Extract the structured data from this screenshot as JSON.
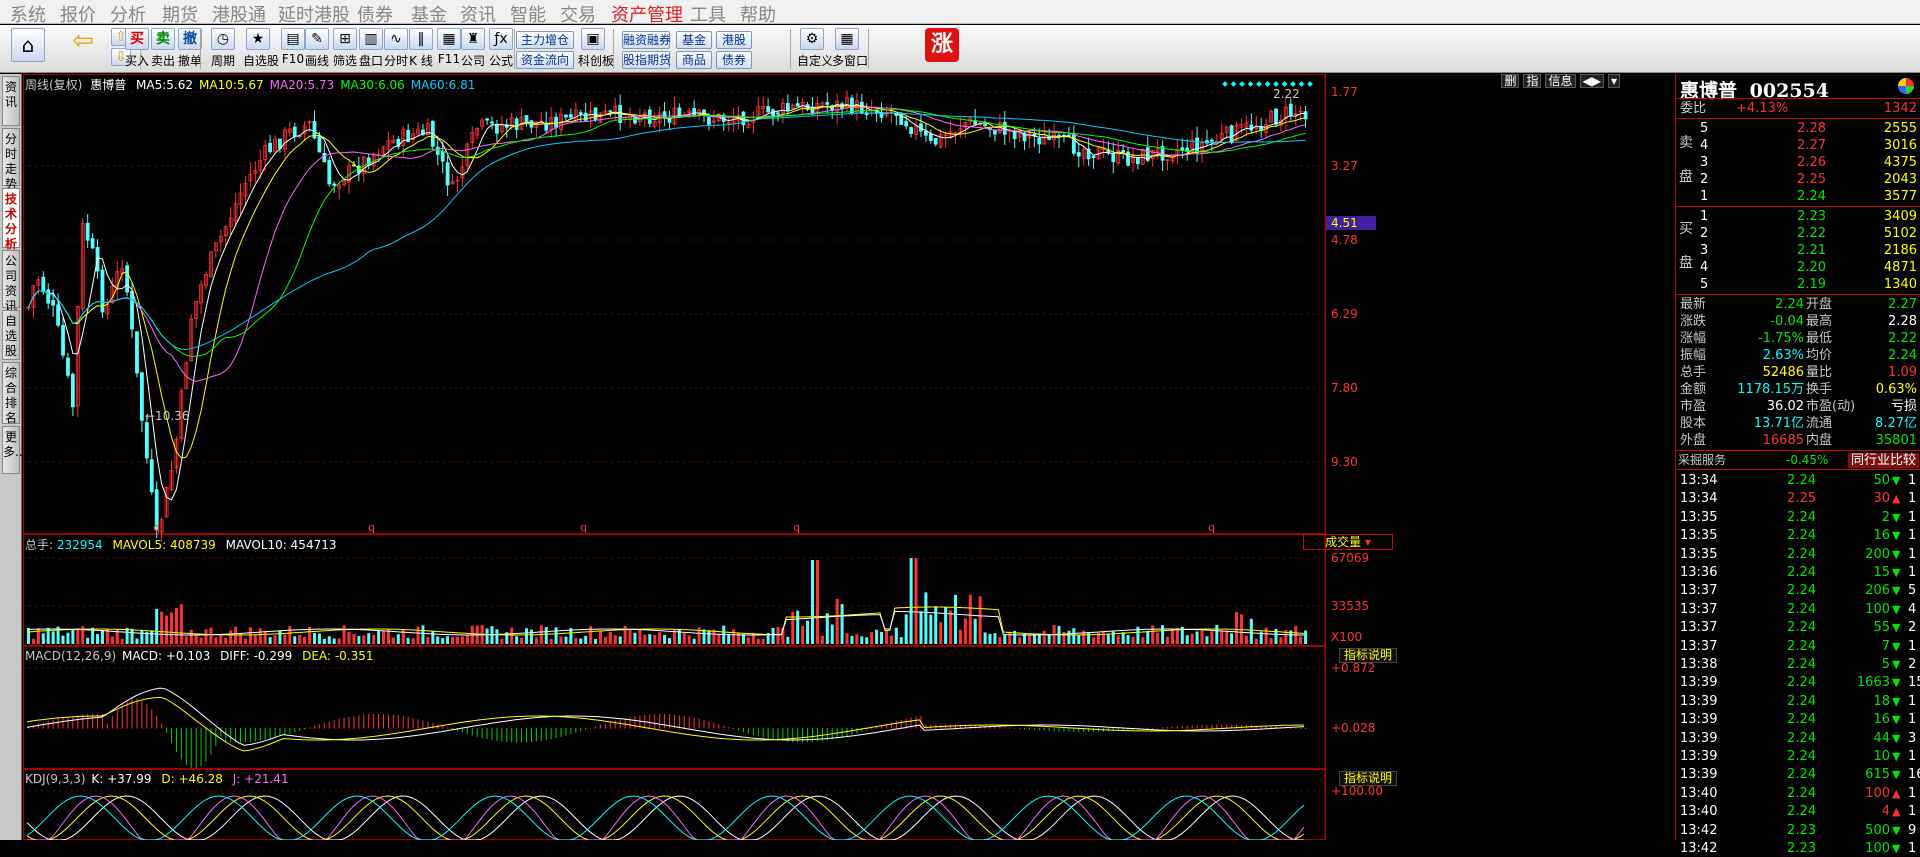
{
  "menu": [
    "系统",
    "报价",
    "分析",
    "期货",
    "港股通",
    "延时港股",
    "债券",
    "基金",
    "资讯",
    "智能",
    "交易",
    "资产管理",
    "工具",
    "帮助"
  ],
  "menu_active": "资产管理",
  "toolbar": {
    "buttons": [
      {
        "label": "买入",
        "icon": "买"
      },
      {
        "label": "卖出",
        "icon": "卖"
      },
      {
        "label": "撤单",
        "icon": "撤"
      },
      {
        "label": "周期",
        "icon": "◷"
      },
      {
        "label": "自选股",
        "icon": "★"
      },
      {
        "label": "F10",
        "icon": "▤"
      },
      {
        "label": "画线",
        "icon": "✎"
      },
      {
        "label": "筛选",
        "icon": "⊞"
      },
      {
        "label": "盘口",
        "icon": "▥"
      },
      {
        "label": "分时",
        "icon": "∿"
      },
      {
        "label": "K 线",
        "icon": "‖"
      },
      {
        "label": "F11",
        "icon": "▦"
      },
      {
        "label": "公司",
        "icon": "♜"
      },
      {
        "label": "公式",
        "icon": "ƒx"
      },
      {
        "label": "科创板",
        "icon": "▣"
      },
      {
        "label": "自定义",
        "icon": "⚙"
      },
      {
        "label": "多窗口",
        "icon": "▦"
      }
    ],
    "pills": [
      "主力增仓",
      "资金流向",
      "融资融券",
      "股指期货",
      "基金",
      "商品",
      "港股",
      "债券"
    ],
    "zhang_icon": "涨"
  },
  "sidebar_tabs": [
    "资讯",
    "分时走势",
    "技术分析",
    "公司资讯",
    "自选股",
    "综合排名",
    "更多..."
  ],
  "sidebar_active": 2,
  "kline": {
    "period_label": "周线(复权)",
    "stock_name": "惠博普",
    "ma": [
      {
        "label": "MA5:",
        "value": "5.62",
        "color": "#ffffff"
      },
      {
        "label": "MA10:",
        "value": "5.67",
        "color": "#ffff00"
      },
      {
        "label": "MA20:",
        "value": "5.73",
        "color": "#ff66ff"
      },
      {
        "label": "MA30:",
        "value": "6.06",
        "color": "#00ff00"
      },
      {
        "label": "MA60:",
        "value": "6.81",
        "color": "#00ccff"
      }
    ],
    "price_ticks": [
      "1.77",
      "3.27",
      "4.78",
      "6.29",
      "7.80",
      "9.30"
    ],
    "cursor_price": "4.51",
    "low_label": "←10.36",
    "high_label": "2.22",
    "top_buttons": [
      "删",
      "指",
      "信息",
      "◀▶",
      "▾"
    ],
    "q_marks": [
      "q",
      "q",
      "q",
      "q",
      "q"
    ]
  },
  "volume": {
    "label": "总手:",
    "value": "232954",
    "mavol5_label": "MAVOL5:",
    "mavol5": "408739",
    "mavol10_label": "MAVOL10:",
    "mavol10": "454713",
    "ticks": [
      "67069",
      "33535",
      "X100"
    ],
    "selector": "成交量"
  },
  "macd": {
    "label": "MACD(12,26,9)",
    "macd_label": "MACD:",
    "macd_value": "+0.103",
    "diff_label": "DIFF:",
    "diff_value": "-0.299",
    "dea_label": "DEA:",
    "dea_value": "-0.351",
    "ticks": [
      "+0.872",
      "+0.028"
    ],
    "help": "指标说明"
  },
  "kdj": {
    "label": "KDJ(9,3,3)",
    "k_label": "K:",
    "k": "+37.99",
    "d_label": "D:",
    "d": "+46.28",
    "j_label": "J:",
    "j": "+21.41",
    "ticks": [
      "+100.00"
    ],
    "help": "指标说明"
  },
  "quote": {
    "name": "惠博普",
    "code": "002554",
    "weibi_label": "委比",
    "weibi": "+4.13%",
    "weicha": "1342",
    "sell_label": [
      "卖",
      "盘"
    ],
    "buy_label": [
      "买",
      "盘"
    ],
    "sell": [
      {
        "lv": "5",
        "price": "2.28",
        "vol": "2555"
      },
      {
        "lv": "4",
        "price": "2.27",
        "vol": "3016"
      },
      {
        "lv": "3",
        "price": "2.26",
        "vol": "4375"
      },
      {
        "lv": "2",
        "price": "2.25",
        "vol": "2043"
      },
      {
        "lv": "1",
        "price": "2.24",
        "vol": "3577"
      }
    ],
    "buy": [
      {
        "lv": "1",
        "price": "2.23",
        "vol": "3409"
      },
      {
        "lv": "2",
        "price": "2.22",
        "vol": "5102"
      },
      {
        "lv": "3",
        "price": "2.21",
        "vol": "2186"
      },
      {
        "lv": "4",
        "price": "2.20",
        "vol": "4871"
      },
      {
        "lv": "5",
        "price": "2.19",
        "vol": "1340"
      }
    ],
    "stats": [
      {
        "l1": "最新",
        "v1": "2.24",
        "c1": "green",
        "l2": "开盘",
        "v2": "2.27",
        "c2": "green"
      },
      {
        "l1": "涨跌",
        "v1": "-0.04",
        "c1": "green",
        "l2": "最高",
        "v2": "2.28",
        "c2": "white"
      },
      {
        "l1": "涨幅",
        "v1": "-1.75%",
        "c1": "green",
        "l2": "最低",
        "v2": "2.22",
        "c2": "green"
      },
      {
        "l1": "振幅",
        "v1": "2.63%",
        "c1": "cyan",
        "l2": "均价",
        "v2": "2.24",
        "c2": "green"
      },
      {
        "l1": "总手",
        "v1": "52486",
        "c1": "yellow",
        "l2": "量比",
        "v2": "1.09",
        "c2": "red"
      },
      {
        "l1": "金额",
        "v1": "1178.15万",
        "c1": "cyan",
        "l2": "换手",
        "v2": "0.63%",
        "c2": "yellow"
      },
      {
        "l1": "市盈",
        "v1": "36.02",
        "c1": "white",
        "l2": "市盈(动)",
        "v2": "亏损",
        "c2": "white"
      },
      {
        "l1": "股本",
        "v1": "13.71亿",
        "c1": "cyan",
        "l2": "流通",
        "v2": "8.27亿",
        "c2": "cyan"
      },
      {
        "l1": "外盘",
        "v1": "16685",
        "c1": "red",
        "l2": "内盘",
        "v2": "35801",
        "c2": "green"
      }
    ],
    "sector_label": "采掘服务",
    "sector_change": "-0.45%",
    "compare_btn": "同行业比较",
    "ticks": [
      {
        "t": "13:34",
        "p": "2.24",
        "v": "50",
        "d": "down",
        "n": "1"
      },
      {
        "t": "13:34",
        "p": "2.25",
        "v": "30",
        "d": "up",
        "n": "1"
      },
      {
        "t": "13:35",
        "p": "2.24",
        "v": "2",
        "d": "down",
        "n": "1"
      },
      {
        "t": "13:35",
        "p": "2.24",
        "v": "16",
        "d": "down",
        "n": "1"
      },
      {
        "t": "13:35",
        "p": "2.24",
        "v": "200",
        "d": "down",
        "n": "1"
      },
      {
        "t": "13:36",
        "p": "2.24",
        "v": "15",
        "d": "down",
        "n": "1"
      },
      {
        "t": "13:37",
        "p": "2.24",
        "v": "206",
        "d": "down",
        "n": "5"
      },
      {
        "t": "13:37",
        "p": "2.24",
        "v": "100",
        "d": "down",
        "n": "4"
      },
      {
        "t": "13:37",
        "p": "2.24",
        "v": "55",
        "d": "down",
        "n": "2"
      },
      {
        "t": "13:37",
        "p": "2.24",
        "v": "7",
        "d": "down",
        "n": "1"
      },
      {
        "t": "13:38",
        "p": "2.24",
        "v": "5",
        "d": "down",
        "n": "2"
      },
      {
        "t": "13:39",
        "p": "2.24",
        "v": "1663",
        "d": "down",
        "n": "15"
      },
      {
        "t": "13:39",
        "p": "2.24",
        "v": "18",
        "d": "down",
        "n": "1"
      },
      {
        "t": "13:39",
        "p": "2.24",
        "v": "16",
        "d": "down",
        "n": "1"
      },
      {
        "t": "13:39",
        "p": "2.24",
        "v": "44",
        "d": "down",
        "n": "3"
      },
      {
        "t": "13:39",
        "p": "2.24",
        "v": "10",
        "d": "down",
        "n": "1"
      },
      {
        "t": "13:39",
        "p": "2.24",
        "v": "615",
        "d": "down",
        "n": "16"
      },
      {
        "t": "13:40",
        "p": "2.24",
        "v": "100",
        "d": "up",
        "n": "1"
      },
      {
        "t": "13:40",
        "p": "2.24",
        "v": "4",
        "d": "up",
        "n": "1"
      },
      {
        "t": "13:42",
        "p": "2.23",
        "v": "500",
        "d": "down",
        "n": "9"
      },
      {
        "t": "13:42",
        "p": "2.23",
        "v": "100",
        "d": "down",
        "n": "1"
      }
    ]
  }
}
